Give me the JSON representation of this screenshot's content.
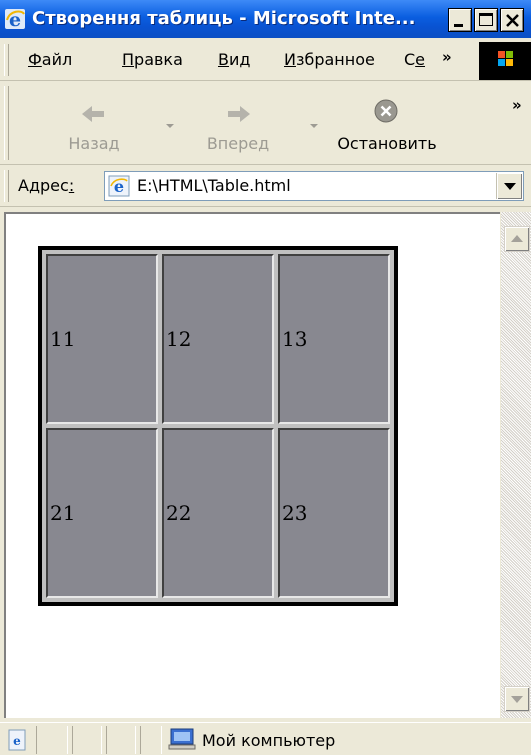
{
  "window": {
    "title": "Створення таблиць - Microsoft Inte..."
  },
  "menu": {
    "items": [
      {
        "label": "Файл",
        "accel": "Ф",
        "rest": "айл"
      },
      {
        "label": "Правка",
        "accel": "П",
        "rest": "равка"
      },
      {
        "label": "Вид",
        "accel": "В",
        "rest": "ид"
      },
      {
        "label": "Избранное",
        "accel": "И",
        "rest": "збранное"
      },
      {
        "label": "Се",
        "accel": "е",
        "rest": ""
      }
    ],
    "more": "»"
  },
  "toolbar": {
    "back_label": "Назад",
    "forward_label": "Вперед",
    "stop_label": "Остановить",
    "more": "»"
  },
  "address": {
    "label": "Адрес",
    "value": "E:\\HTML\\Table.html"
  },
  "table": {
    "rows": [
      [
        "11",
        "12",
        "13"
      ],
      [
        "21",
        "22",
        "23"
      ]
    ]
  },
  "status": {
    "zone_label": "Мой компьютер"
  },
  "colors": {
    "titlebar": "#0a5ee0",
    "cell_bg": "#888890",
    "table_border": "#000000"
  }
}
